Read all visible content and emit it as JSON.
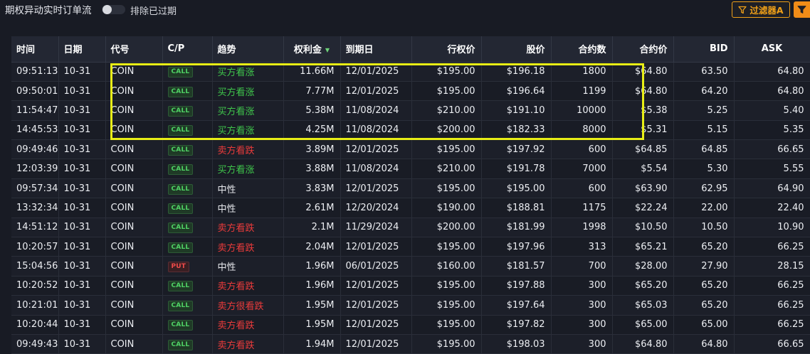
{
  "header": {
    "title": "期权异动实时订单流",
    "exclude_expired_label": "排除已过期",
    "filter_label": "过滤器A"
  },
  "columns": [
    "时间",
    "日期",
    "代号",
    "C/P",
    "趋势",
    "权利金",
    "到期日",
    "行权价",
    "股价",
    "合约数",
    "合约价",
    "BID",
    "ASK"
  ],
  "rows": [
    {
      "time": "09:51:13",
      "date": "10-31",
      "symbol": "COIN",
      "cp": "CALL",
      "trend": "买方看涨",
      "trend_kind": "up",
      "premium": "11.66M",
      "expiry": "12/01/2025",
      "strike": "$195.00",
      "stock": "$196.18",
      "contracts": "1800",
      "price": "$64.80",
      "bid": "63.50",
      "ask": "64.80"
    },
    {
      "time": "09:50:01",
      "date": "10-31",
      "symbol": "COIN",
      "cp": "CALL",
      "trend": "买方看涨",
      "trend_kind": "up",
      "premium": "7.77M",
      "expiry": "12/01/2025",
      "strike": "$195.00",
      "stock": "$196.64",
      "contracts": "1199",
      "price": "$64.80",
      "bid": "64.20",
      "ask": "64.80"
    },
    {
      "time": "11:54:47",
      "date": "10-31",
      "symbol": "COIN",
      "cp": "CALL",
      "trend": "买方看涨",
      "trend_kind": "up",
      "premium": "5.38M",
      "expiry": "11/08/2024",
      "strike": "$210.00",
      "stock": "$191.10",
      "contracts": "10000",
      "price": "$5.38",
      "bid": "5.25",
      "ask": "5.40"
    },
    {
      "time": "14:45:53",
      "date": "10-31",
      "symbol": "COIN",
      "cp": "CALL",
      "trend": "买方看涨",
      "trend_kind": "up",
      "premium": "4.25M",
      "expiry": "11/08/2024",
      "strike": "$200.00",
      "stock": "$182.33",
      "contracts": "8000",
      "price": "$5.31",
      "bid": "5.15",
      "ask": "5.35"
    },
    {
      "time": "09:49:46",
      "date": "10-31",
      "symbol": "COIN",
      "cp": "CALL",
      "trend": "卖方看跌",
      "trend_kind": "down",
      "premium": "3.89M",
      "expiry": "12/01/2025",
      "strike": "$195.00",
      "stock": "$197.92",
      "contracts": "600",
      "price": "$64.85",
      "bid": "64.85",
      "ask": "66.65"
    },
    {
      "time": "12:03:39",
      "date": "10-31",
      "symbol": "COIN",
      "cp": "CALL",
      "trend": "买方看涨",
      "trend_kind": "up",
      "premium": "3.88M",
      "expiry": "11/08/2024",
      "strike": "$210.00",
      "stock": "$191.78",
      "contracts": "7000",
      "price": "$5.54",
      "bid": "5.30",
      "ask": "5.55"
    },
    {
      "time": "09:57:34",
      "date": "10-31",
      "symbol": "COIN",
      "cp": "CALL",
      "trend": "中性",
      "trend_kind": "neutral",
      "premium": "3.83M",
      "expiry": "12/01/2025",
      "strike": "$195.00",
      "stock": "$195.00",
      "contracts": "600",
      "price": "$63.90",
      "bid": "62.95",
      "ask": "64.90"
    },
    {
      "time": "13:32:34",
      "date": "10-31",
      "symbol": "COIN",
      "cp": "CALL",
      "trend": "中性",
      "trend_kind": "neutral",
      "premium": "2.61M",
      "expiry": "12/20/2024",
      "strike": "$190.00",
      "stock": "$188.81",
      "contracts": "1175",
      "price": "$22.24",
      "bid": "22.00",
      "ask": "22.40"
    },
    {
      "time": "14:51:12",
      "date": "10-31",
      "symbol": "COIN",
      "cp": "CALL",
      "trend": "卖方看跌",
      "trend_kind": "down",
      "premium": "2.1M",
      "expiry": "11/29/2024",
      "strike": "$200.00",
      "stock": "$181.99",
      "contracts": "1998",
      "price": "$10.50",
      "bid": "10.50",
      "ask": "10.90"
    },
    {
      "time": "10:20:57",
      "date": "10-31",
      "symbol": "COIN",
      "cp": "CALL",
      "trend": "卖方看跌",
      "trend_kind": "down",
      "premium": "2.04M",
      "expiry": "12/01/2025",
      "strike": "$195.00",
      "stock": "$197.96",
      "contracts": "313",
      "price": "$65.21",
      "bid": "65.20",
      "ask": "66.25"
    },
    {
      "time": "15:04:56",
      "date": "10-31",
      "symbol": "COIN",
      "cp": "PUT",
      "trend": "中性",
      "trend_kind": "neutral",
      "premium": "1.96M",
      "expiry": "06/01/2025",
      "strike": "$160.00",
      "stock": "$181.57",
      "contracts": "700",
      "price": "$28.00",
      "bid": "27.90",
      "ask": "28.15"
    },
    {
      "time": "10:20:52",
      "date": "10-31",
      "symbol": "COIN",
      "cp": "CALL",
      "trend": "卖方看跌",
      "trend_kind": "down",
      "premium": "1.96M",
      "expiry": "12/01/2025",
      "strike": "$195.00",
      "stock": "$197.88",
      "contracts": "300",
      "price": "$65.20",
      "bid": "65.20",
      "ask": "66.25"
    },
    {
      "time": "10:21:01",
      "date": "10-31",
      "symbol": "COIN",
      "cp": "CALL",
      "trend": "卖方很看跌",
      "trend_kind": "down",
      "premium": "1.95M",
      "expiry": "12/01/2025",
      "strike": "$195.00",
      "stock": "$197.64",
      "contracts": "300",
      "price": "$65.03",
      "bid": "65.20",
      "ask": "66.25"
    },
    {
      "time": "10:20:44",
      "date": "10-31",
      "symbol": "COIN",
      "cp": "CALL",
      "trend": "卖方看跌",
      "trend_kind": "down",
      "premium": "1.95M",
      "expiry": "12/01/2025",
      "strike": "$195.00",
      "stock": "$197.82",
      "contracts": "300",
      "price": "$65.00",
      "bid": "65.00",
      "ask": "66.25"
    },
    {
      "time": "09:49:43",
      "date": "10-31",
      "symbol": "COIN",
      "cp": "CALL",
      "trend": "卖方看跌",
      "trend_kind": "down",
      "premium": "1.94M",
      "expiry": "12/01/2025",
      "strike": "$195.00",
      "stock": "$198.03",
      "contracts": "300",
      "price": "$64.80",
      "bid": "64.80",
      "ask": "66.65"
    }
  ],
  "colors": {
    "up": "#3fc54b",
    "down": "#ea3b3b",
    "accent": "#f0a018",
    "highlight": "#e8ee16"
  }
}
